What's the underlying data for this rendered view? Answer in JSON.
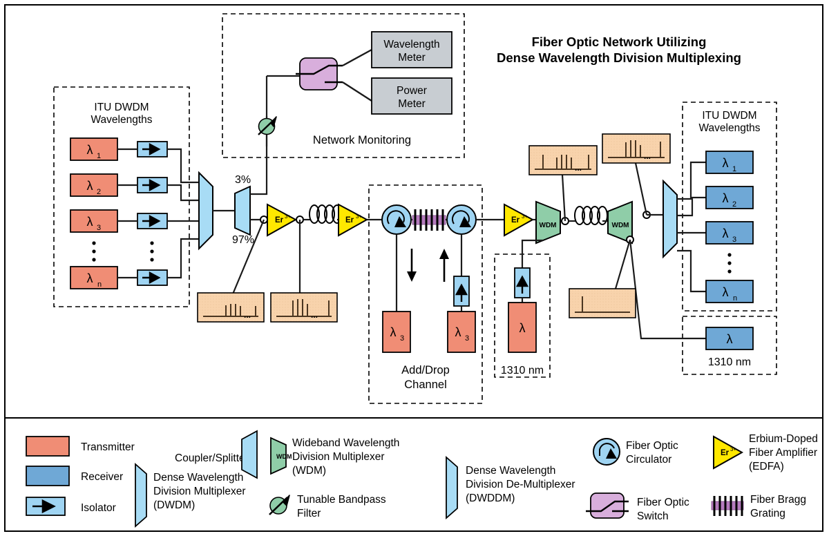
{
  "title": {
    "line1": "Fiber Optic Network Utilizing",
    "line2": "Dense Wavelength Division Multiplexing"
  },
  "groups": {
    "tx_group_label_1": "ITU DWDM",
    "tx_group_label_2": "Wavelengths",
    "rx_group_label_1": "ITU DWDM",
    "rx_group_label_2": "Wavelengths",
    "monitoring_label": "Network Monitoring",
    "adddrop_label_1": "Add/Drop",
    "adddrop_label_2": "Channel",
    "add1310_label": "1310 nm",
    "rx1310_label": "1310 nm"
  },
  "transmitters": [
    {
      "name": "tx-lambda-1",
      "label": "λ",
      "sub": "1"
    },
    {
      "name": "tx-lambda-2",
      "label": "λ",
      "sub": "2"
    },
    {
      "name": "tx-lambda-3",
      "label": "λ",
      "sub": "3"
    },
    {
      "name": "tx-lambda-n",
      "label": "λ",
      "sub": "n"
    }
  ],
  "receivers": [
    {
      "name": "rx-lambda-1",
      "label": "λ",
      "sub": "1"
    },
    {
      "name": "rx-lambda-2",
      "label": "λ",
      "sub": "2"
    },
    {
      "name": "rx-lambda-3",
      "label": "λ",
      "sub": "3"
    },
    {
      "name": "rx-lambda-n",
      "label": "λ",
      "sub": "n"
    }
  ],
  "splitter": {
    "tap_ratio": "3%",
    "through_ratio": "97%"
  },
  "monitoring": {
    "wavelength_meter_1": "Wavelength",
    "wavelength_meter_2": "Meter",
    "power_meter_1": "Power",
    "power_meter_2": "Meter"
  },
  "amplifiers": {
    "edfa_label": "Er",
    "edfa_sup": "3+"
  },
  "wdm": {
    "label": "WDM"
  },
  "adddrop": {
    "drop_lambda": "λ",
    "drop_sub": "3",
    "add_lambda": "λ",
    "add_sub": "3"
  },
  "add1310": {
    "lambda": "λ"
  },
  "rx1310": {
    "lambda": "λ"
  },
  "ellipsis": "...",
  "legend": [
    {
      "name": "legend-transmitter",
      "icon": "transmitter-swatch",
      "lines": [
        "Transmitter"
      ]
    },
    {
      "name": "legend-receiver",
      "icon": "receiver-swatch",
      "lines": [
        "Receiver"
      ]
    },
    {
      "name": "legend-isolator",
      "icon": "isolator-icon",
      "lines": [
        "Isolator"
      ]
    },
    {
      "name": "legend-dwdm",
      "icon": "dwdm-icon",
      "lines": [
        "Dense Wavelength",
        "Division Multiplexer",
        "(DWDM)"
      ]
    },
    {
      "name": "legend-coupler-splitter",
      "icon": "coupler-splitter-icon",
      "lines": [
        "Coupler/Splitter"
      ]
    },
    {
      "name": "legend-wdm",
      "icon": "wdm-icon",
      "lines": [
        "Wideband Wavelength",
        "Division Multiplexer",
        "(WDM)"
      ]
    },
    {
      "name": "legend-tunable-filter",
      "icon": "tunable-filter-icon",
      "lines": [
        "Tunable Bandpass",
        "Filter"
      ]
    },
    {
      "name": "legend-dwddm",
      "icon": "dwddm-icon",
      "lines": [
        "Dense Wavelength",
        "Division De-Multiplexer",
        "(DWDDM)"
      ]
    },
    {
      "name": "legend-circulator",
      "icon": "circulator-icon",
      "lines": [
        "Fiber Optic",
        "Circulator"
      ]
    },
    {
      "name": "legend-switch",
      "icon": "fiber-switch-icon",
      "lines": [
        "Fiber Optic",
        "Switch"
      ]
    },
    {
      "name": "legend-edfa",
      "icon": "edfa-icon",
      "lines": [
        "Erbium-Doped",
        "Fiber Amplifier",
        "(EDFA)"
      ]
    },
    {
      "name": "legend-fbg",
      "icon": "fbg-icon",
      "lines": [
        "Fiber Bragg",
        "Grating"
      ]
    }
  ],
  "colors": {
    "transmitter": "#F08D75",
    "receiver": "#6FA8D6",
    "isolator": "#9FD4F2",
    "dwdm": "#A8DCF5",
    "wdm": "#8FCDA8",
    "edfa": "#FFE800",
    "circulator": "#9FD4F2",
    "switch": "#D8AEDC",
    "grating": "#B57BBE",
    "spectrum": "#F8D3AC",
    "meter": "#C8CDD2",
    "filter": "#8FCDA8",
    "line": "#1A1A1A"
  },
  "chart_data": [
    {
      "name": "spectrum-tap-3pct",
      "type": "bar",
      "title": "",
      "description": "Low-amplitude DWDM channel comb tapped from 3% port",
      "x": [
        1,
        2,
        3,
        4,
        5,
        6,
        7
      ],
      "values": [
        0.62,
        0.78,
        0.78,
        0.62,
        0.0,
        0.0,
        0.72
      ],
      "ellipsis_after_index": 4
    },
    {
      "name": "spectrum-post-edfa",
      "type": "bar",
      "title": "",
      "description": "Amplified DWDM channel comb after first EDFA",
      "x": [
        1,
        2,
        3,
        4,
        5,
        6,
        7
      ],
      "values": [
        0.88,
        0.95,
        0.95,
        0.72,
        0.0,
        0.0,
        0.88
      ],
      "ellipsis_after_index": 4
    },
    {
      "name": "spectrum-wdm-with-1310",
      "type": "bar",
      "title": "",
      "description": "DWDM comb plus 1310 nm service channel spike at left",
      "x": [
        1,
        2,
        3,
        4,
        5,
        6,
        7,
        8
      ],
      "values": [
        0.82,
        0.0,
        0.7,
        0.88,
        0.88,
        0.7,
        0.0,
        0.82
      ],
      "ellipsis_after_index": 6
    },
    {
      "name": "spectrum-dwdm-only",
      "type": "bar",
      "title": "",
      "description": "DWDM comb after second WDM, 1310 nm removed",
      "x": [
        1,
        2,
        3,
        4,
        5,
        6,
        7
      ],
      "values": [
        0.85,
        0.95,
        0.95,
        0.72,
        0.0,
        0.0,
        0.9
      ],
      "ellipsis_after_index": 4
    },
    {
      "name": "spectrum-1310-only",
      "type": "bar",
      "title": "",
      "description": "Single 1310 nm service channel dropped by second WDM",
      "x": [
        1
      ],
      "values": [
        0.85
      ],
      "ellipsis_after_index": -1
    }
  ]
}
